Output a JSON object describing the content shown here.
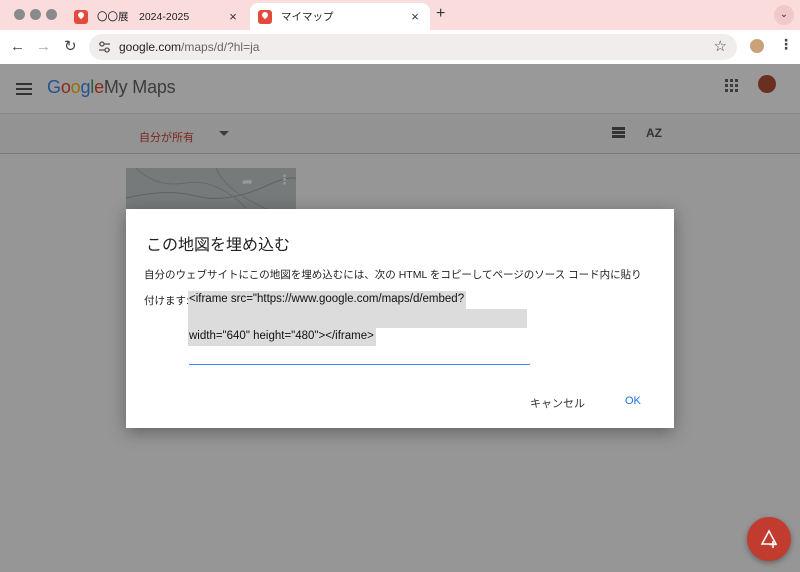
{
  "browser": {
    "tabs": [
      {
        "title": "〇〇展　2024-2025",
        "active": false
      },
      {
        "title": "マイマップ",
        "active": true
      }
    ],
    "new_tab_glyph": "+",
    "close_glyph": "×",
    "tab_menu_glyph": "⌄",
    "back_glyph": "←",
    "forward_glyph": "→",
    "reload_glyph": "↻",
    "url_host": "google.com",
    "url_path": "/maps/d/?hl=ja",
    "bookmark_glyph": "☆",
    "menu_glyph": "⋮"
  },
  "app": {
    "logo_letters": [
      "G",
      "o",
      "o",
      "g",
      "l",
      "e"
    ],
    "logo_suffix": "My Maps",
    "filter_label": "自分が所有",
    "sort_label": "AZ",
    "card_share_glyph": "➦",
    "card_more_glyph": "⋮"
  },
  "dialog": {
    "title": "この地図を埋め込む",
    "description": "自分のウェブサイトにこの地図を埋め込むには、次の HTML をコピーしてページのソース コード内に貼り",
    "description_cont": "付けます:",
    "code_line1": "<iframe src=\"https://www.google.com/maps/d/embed?",
    "code_line2": "width=\"640\" height=\"480\"></iframe>",
    "cancel_label": "キャンセル",
    "ok_label": "OK"
  },
  "colors": {
    "tab_strip": "#fadcdc",
    "brand_red": "#d23f31",
    "fab": "#c13b2f",
    "link_blue": "#1a73e8",
    "highlight": "#dcdcdc"
  },
  "icons": {
    "hamburger": "menu-icon",
    "apps": "apps-grid-icon",
    "list_view": "list-view-icon",
    "sort": "sort-az-icon",
    "fab": "add-map-icon",
    "site_info": "tune-icon",
    "favicon": "maps-pin-icon"
  }
}
